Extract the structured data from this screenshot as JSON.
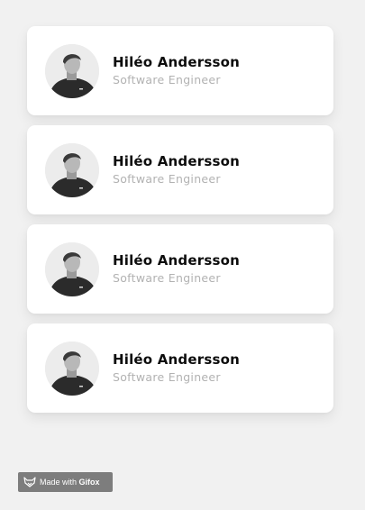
{
  "profiles": [
    {
      "name": "Hiléo Andersson",
      "role": "Software Engineer",
      "avatar": "person-photo"
    },
    {
      "name": "Hiléo Andersson",
      "role": "Software Engineer",
      "avatar": "person-photo"
    },
    {
      "name": "Hiléo Andersson",
      "role": "Software Engineer",
      "avatar": "person-photo"
    },
    {
      "name": "Hiléo Andersson",
      "role": "Software Engineer",
      "avatar": "person-photo"
    }
  ],
  "badge": {
    "prefix": "Made with",
    "brand": "Gifox",
    "icon": "fox-logo-icon"
  },
  "colors": {
    "background": "#f1f1f1",
    "card": "#ffffff",
    "name": "#0d0d0d",
    "role": "#b2b2b2",
    "badge": "#7d7d7d"
  }
}
